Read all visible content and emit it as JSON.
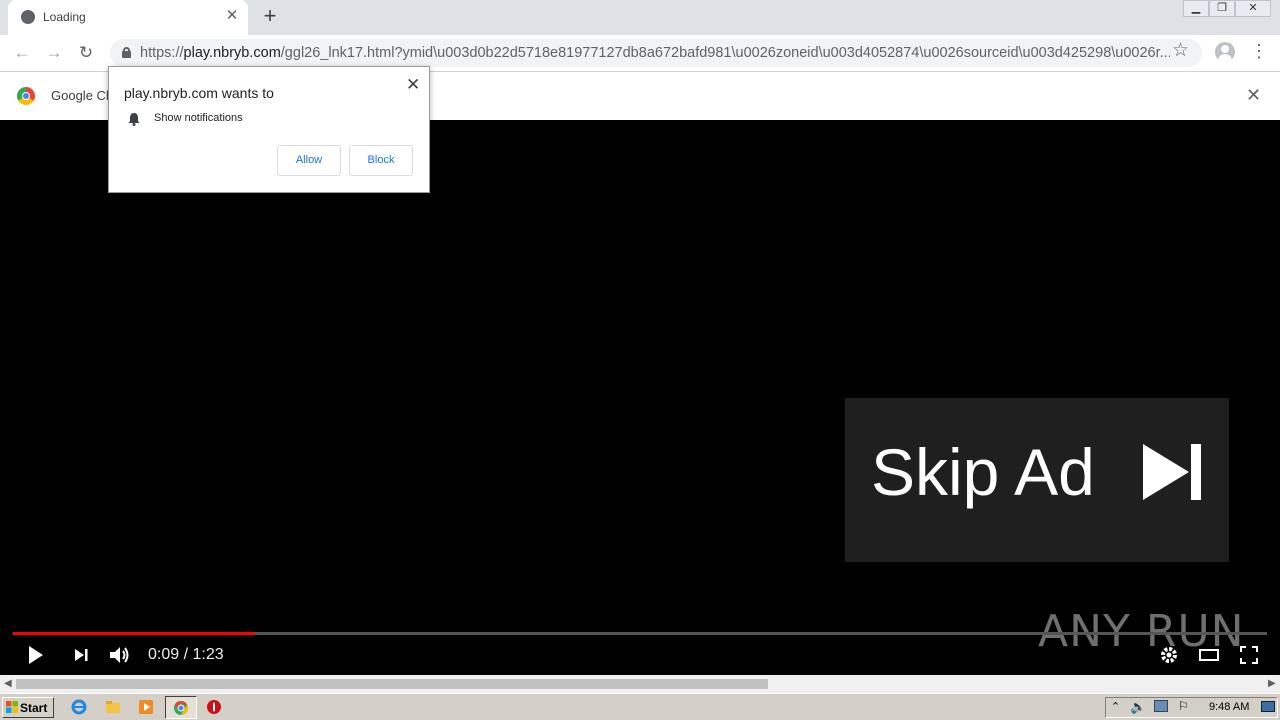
{
  "browser": {
    "tab_title": "Loading",
    "new_tab_symbol": "+",
    "url_scheme": "https://",
    "url_host": "play.nbryb.com",
    "url_rest": "/ggl26_lnk17.html?ymid\\u003d0b22d5718e81977127db8a672bafd981\\u0026zoneid\\u003d4052874\\u0026sourceid\\u003d425298\\u0026r...",
    "infobar_text": "Google Ch"
  },
  "permission_popup": {
    "title": "play.nbryb.com wants to",
    "item": "Show notifications",
    "allow_label": "Allow",
    "block_label": "Block"
  },
  "video": {
    "skip_ad_label": "Skip Ad",
    "time_display": "0:09 / 1:23",
    "progress_fraction": 0.193,
    "progress_color": "#ff0000",
    "watermark": "ANY RUN"
  },
  "taskbar": {
    "start_label": "Start",
    "clock": "9:48 AM"
  },
  "icons": [
    "globe-icon",
    "close-icon",
    "back-icon",
    "forward-icon",
    "reload-icon",
    "lock-icon",
    "star-icon",
    "profile-icon",
    "menu-icon",
    "chrome-logo-icon",
    "bell-icon",
    "play-icon",
    "next-icon",
    "volume-icon",
    "settings-icon",
    "theater-icon",
    "fullscreen-icon"
  ]
}
